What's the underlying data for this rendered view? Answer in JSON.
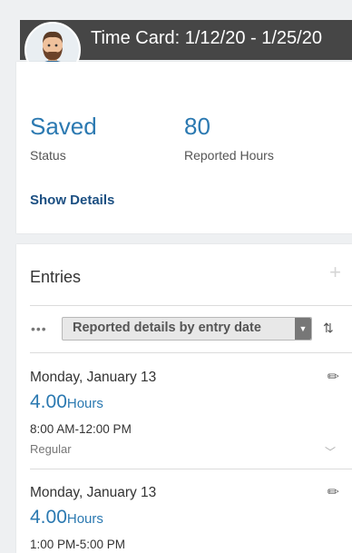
{
  "header": {
    "title": "Time Card: 1/12/20 - 1/25/20"
  },
  "summary": {
    "status_value": "Saved",
    "status_label": "Status",
    "hours_value": "80",
    "hours_label": "Reported Hours",
    "show_details": "Show Details"
  },
  "entries": {
    "title": "Entries",
    "add_icon": "+",
    "more_icon": "•••",
    "sort_dropdown": "Reported details by entry date",
    "dropdown_caret": "▼",
    "sort_icon": "⇅",
    "items": [
      {
        "date": "Monday, January 13",
        "hours": "4.00",
        "unit": "Hours",
        "range": "8:00 AM-12:00 PM",
        "type": "Regular"
      },
      {
        "date": "Monday, January 13",
        "hours": "4.00",
        "unit": "Hours",
        "range": "1:00 PM-5:00 PM",
        "type": ""
      }
    ]
  },
  "colors": {
    "accent": "#2b79b1",
    "header_bg": "#464646",
    "link": "#1b4f82"
  }
}
